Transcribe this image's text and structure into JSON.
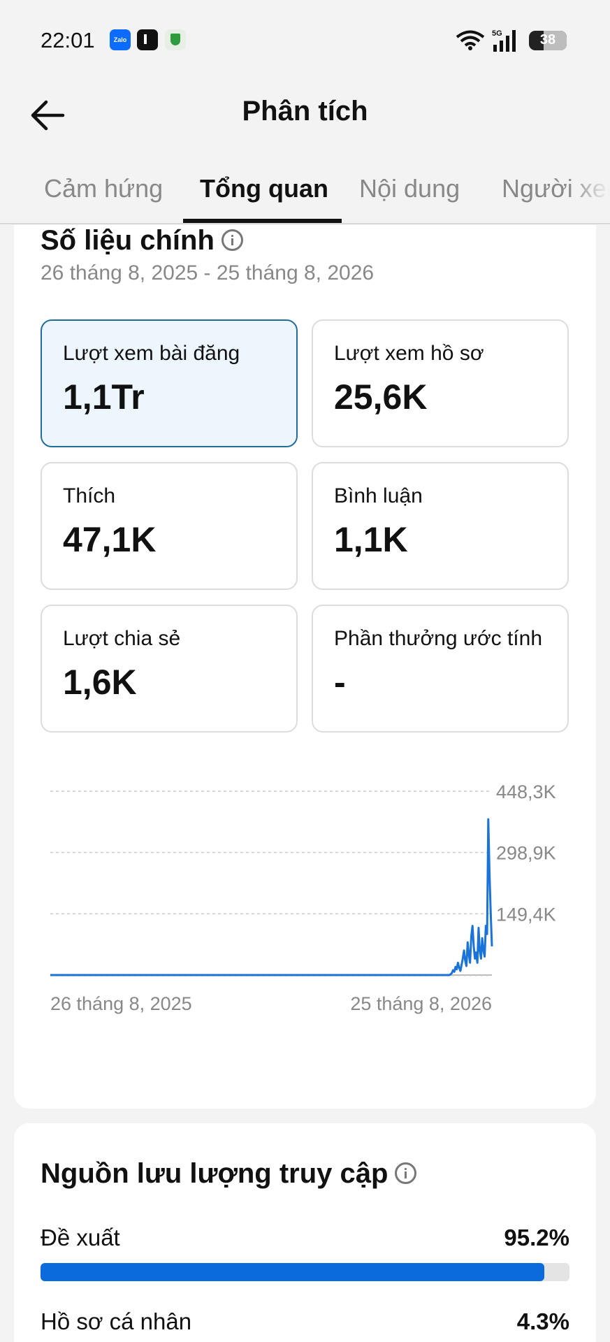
{
  "status_bar": {
    "time": "22:01",
    "app_icons": [
      "zalo-icon",
      "tiktok-icon",
      "shield-icon"
    ],
    "zalo_label": "Zalo",
    "network": "5G",
    "battery": "38",
    "battery_level": 0.38
  },
  "header": {
    "title": "Phân tích"
  },
  "tabs": [
    {
      "label": "Cảm hứng",
      "active": false
    },
    {
      "label": "Tổng quan",
      "active": true
    },
    {
      "label": "Nội dung",
      "active": false
    },
    {
      "label": "Người xem",
      "active": false
    }
  ],
  "key_metrics": {
    "title": "Số liệu chính",
    "date_range": "26 tháng 8, 2025 - 25 tháng 8, 2026",
    "items": [
      {
        "label": "Lượt xem bài đăng",
        "value": "1,1Tr",
        "selected": true
      },
      {
        "label": "Lượt xem hồ sơ",
        "value": "25,6K",
        "selected": false
      },
      {
        "label": "Thích",
        "value": "47,1K",
        "selected": false
      },
      {
        "label": "Bình luận",
        "value": "1,1K",
        "selected": false
      },
      {
        "label": "Lượt chia sẻ",
        "value": "1,6K",
        "selected": false
      },
      {
        "label": "Phần thưởng ước tính",
        "value": "-",
        "selected": false
      }
    ]
  },
  "chart_data": {
    "type": "line",
    "title": "",
    "x_labels": [
      "26 tháng 8, 2025",
      "25 tháng 8, 2026"
    ],
    "y_ticks": [
      "448,3K",
      "298,9K",
      "149,4K"
    ],
    "y_tick_values": [
      448300,
      298900,
      149400
    ],
    "ylim": [
      0,
      448300
    ],
    "grid": true,
    "series": [
      {
        "color": "#1a73d9",
        "x": [
          0,
          329,
          330,
          331,
          332,
          333,
          334,
          335,
          336,
          337,
          338,
          339,
          340,
          341,
          342,
          343,
          344,
          345,
          346,
          347,
          348,
          349,
          350,
          351,
          352,
          353,
          354,
          355,
          356,
          357,
          358,
          359,
          360,
          361,
          362,
          363,
          364
        ],
        "y": [
          0,
          0,
          2000,
          5000,
          12000,
          8000,
          20000,
          14000,
          30000,
          18000,
          10000,
          25000,
          40000,
          60000,
          35000,
          22000,
          80000,
          50000,
          30000,
          95000,
          120000,
          70000,
          40000,
          55000,
          30000,
          115000,
          60000,
          40000,
          90000,
          60000,
          45000,
          120000,
          100000,
          380000,
          250000,
          150000,
          70000
        ]
      }
    ]
  },
  "traffic": {
    "title": "Nguồn lưu lượng truy cập",
    "items": [
      {
        "label": "Đề xuất",
        "percent_text": "95.2%",
        "percent": 95.2
      },
      {
        "label": "Hồ sơ cá nhân",
        "percent_text": "4.3%",
        "percent": 4.3
      }
    ]
  }
}
